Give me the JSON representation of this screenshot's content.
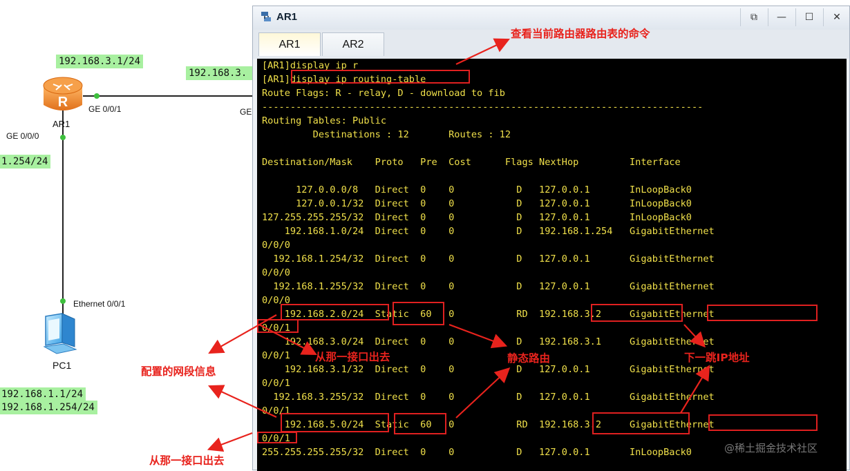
{
  "topology": {
    "labels": {
      "ar1_top_ip": "192.168.3.1/24",
      "ar2_side_ip_partial": "192.168.3.",
      "ar1_left_ip_partial": "1.254/24",
      "pc1_ip": "192.168.1.1/24",
      "pc1_gateway": "192.168.1.254/24"
    },
    "ar1_name": "AR1",
    "router_letter": "R",
    "pc1_name": "PC1",
    "port_ar1_right": "GE 0/0/1",
    "port_ar1_left": "GE 0/0/0",
    "port_ar2_partial": "GE",
    "port_pc1": "Ethernet 0/0/1"
  },
  "window": {
    "title": "AR1",
    "controls": {
      "restore": "⧉",
      "minimize": "—",
      "maximize": "☐",
      "close": "✕"
    },
    "tabs": [
      {
        "label": "AR1",
        "active": true
      },
      {
        "label": "AR2",
        "active": false
      }
    ]
  },
  "terminal": {
    "lines": [
      "[AR1]display ip r",
      "[AR1]display ip routing-table",
      "Route Flags: R - relay, D - download to fib",
      "------------------------------------------------------------------------------",
      "Routing Tables: Public",
      "         Destinations : 12       Routes : 12",
      "",
      "Destination/Mask    Proto   Pre  Cost      Flags NextHop         Interface",
      "",
      "      127.0.0.0/8   Direct  0    0           D   127.0.0.1       InLoopBack0",
      "      127.0.0.1/32  Direct  0    0           D   127.0.0.1       InLoopBack0",
      "127.255.255.255/32  Direct  0    0           D   127.0.0.1       InLoopBack0",
      "    192.168.1.0/24  Direct  0    0           D   192.168.1.254   GigabitEthernet",
      "0/0/0",
      "  192.168.1.254/32  Direct  0    0           D   127.0.0.1       GigabitEthernet",
      "0/0/0",
      "  192.168.1.255/32  Direct  0    0           D   127.0.0.1       GigabitEthernet",
      "0/0/0",
      "    192.168.2.0/24  Static  60   0           RD  192.168.3.2     GigabitEthernet",
      "0/0/1",
      "    192.168.3.0/24  Direct  0    0           D   192.168.3.1     GigabitEthernet",
      "0/0/1",
      "    192.168.3.1/32  Direct  0    0           D   127.0.0.1       GigabitEthernet",
      "0/0/1",
      "  192.168.3.255/32  Direct  0    0           D   127.0.0.1       GigabitEthernet",
      "0/0/1",
      "    192.168.5.0/24  Static  60   0           RD  192.168.3.2     GigabitEthernet",
      "0/0/1",
      "255.255.255.255/32  Direct  0    0           D   127.0.0.1       InLoopBack0"
    ]
  },
  "annotations": {
    "cmd_note": "查看当前路由器路由表的命令",
    "segment_info": "配置的网段信息",
    "exit_iface_1": "从那一接口出去",
    "exit_iface_2": "从那一接口出去",
    "static_route": "静态路由",
    "next_hop": "下一跳IP地址"
  },
  "watermark": "@稀土掘金技术社区",
  "colors": {
    "terminal_bg": "#000000",
    "terminal_text": "#f0e04a",
    "annotation_red": "#e8231d",
    "label_green": "#a8f0a0",
    "router_orange": "#f08a28"
  },
  "icons": [
    "router-icon",
    "pc-icon",
    "app-icon"
  ]
}
